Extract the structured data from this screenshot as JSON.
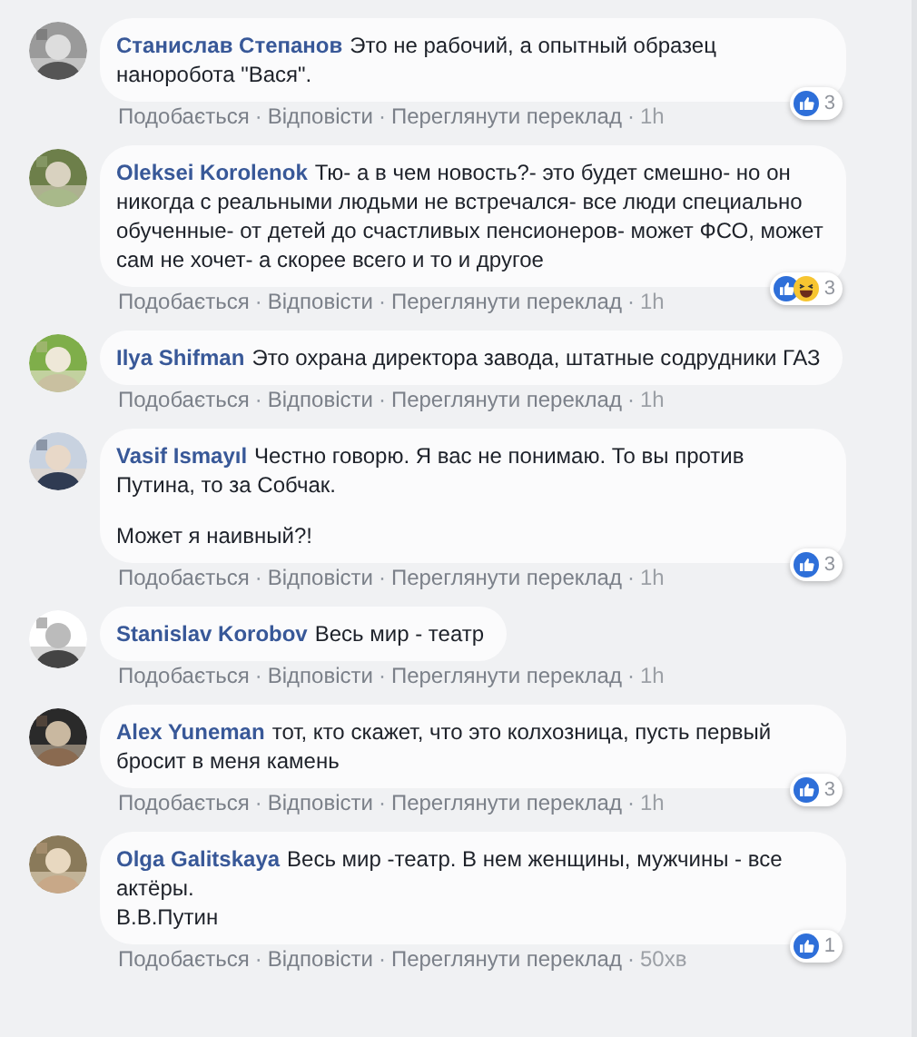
{
  "comments": [
    {
      "author": "Станислав Степанов",
      "paragraphs": [
        "Это не рабочий, а опытный образец наноробота \"Вася\"."
      ],
      "actions": [
        {
          "label": "Подобається",
          "separator": "·"
        },
        {
          "label": "Відповісти",
          "separator": "·"
        },
        {
          "label": "Переглянути переклад",
          "separator": "·"
        }
      ],
      "time": "1h",
      "reactions": {
        "icons": [
          {
            "kind": "like"
          }
        ],
        "count": "3"
      }
    },
    {
      "author": "Oleksei Korolenok",
      "paragraphs": [
        "Тю- а в чем новость?- это будет смешно- но он никогда с реальными людьми не встречался- все люди специально обученные- от детей до счастливых пенсионеров- может ФСО, может сам не хочет- а скорее всего и то и другое"
      ],
      "actions": [
        {
          "label": "Подобається",
          "separator": "·"
        },
        {
          "label": "Відповісти",
          "separator": "·"
        },
        {
          "label": "Переглянути переклад",
          "separator": "·"
        }
      ],
      "time": "1h",
      "reactions": {
        "icons": [
          {
            "kind": "like"
          },
          {
            "kind": "haha"
          }
        ],
        "count": "3"
      }
    },
    {
      "author": "Ilya Shifman",
      "paragraphs": [
        "Это охрана директора завода, штатные содрудники ГАЗ"
      ],
      "actions": [
        {
          "label": "Подобається",
          "separator": "·"
        },
        {
          "label": "Відповісти",
          "separator": "·"
        },
        {
          "label": "Переглянути переклад",
          "separator": "·"
        }
      ],
      "time": "1h"
    },
    {
      "author": "Vasif Ismayıl",
      "paragraphs": [
        "Честно говорю. Я вас не понимаю. То вы против Путина, то за Собчак.",
        "Может я наивный?!"
      ],
      "actions": [
        {
          "label": "Подобається",
          "separator": "·"
        },
        {
          "label": "Відповісти",
          "separator": "·"
        },
        {
          "label": "Переглянути переклад",
          "separator": "·"
        }
      ],
      "time": "1h",
      "reactions": {
        "icons": [
          {
            "kind": "like"
          }
        ],
        "count": "3"
      }
    },
    {
      "author": "Stanislav Korobov",
      "paragraphs": [
        "Весь мир - театр"
      ],
      "actions": [
        {
          "label": "Подобається",
          "separator": "·"
        },
        {
          "label": "Відповісти",
          "separator": "·"
        },
        {
          "label": "Переглянути переклад",
          "separator": "·"
        }
      ],
      "time": "1h"
    },
    {
      "author": "Alex Yuneman",
      "paragraphs": [
        "тот, кто скажет, что это колхозница, пусть первый бросит в меня камень"
      ],
      "actions": [
        {
          "label": "Подобається",
          "separator": "·"
        },
        {
          "label": "Відповісти",
          "separator": "·"
        },
        {
          "label": "Переглянути переклад",
          "separator": "·"
        }
      ],
      "time": "1h",
      "reactions": {
        "icons": [
          {
            "kind": "like"
          }
        ],
        "count": "3"
      }
    },
    {
      "author": "Olga Galitskaya",
      "paragraphs": [
        "Весь мир -театр. В нем женщины, мужчины - все актёры.\nВ.В.Путин"
      ],
      "actions": [
        {
          "label": "Подобається",
          "separator": "·"
        },
        {
          "label": "Відповісти",
          "separator": "·"
        },
        {
          "label": "Переглянути переклад",
          "separator": "·"
        }
      ],
      "time": "50хв",
      "reactions": {
        "icons": [
          {
            "kind": "like"
          }
        ],
        "count": "1"
      }
    }
  ]
}
